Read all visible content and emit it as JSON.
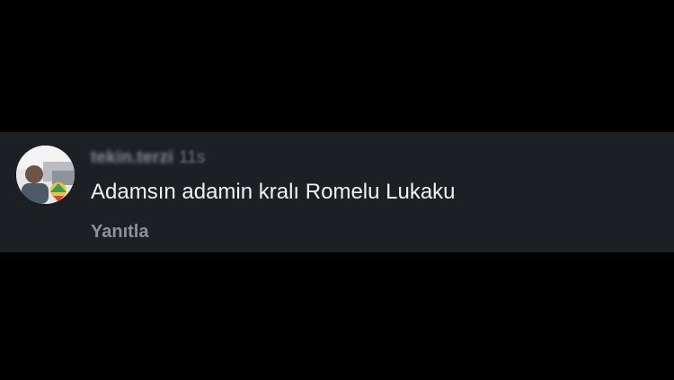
{
  "comment": {
    "username": "tekin.terzi",
    "timestamp": "11s",
    "text": "Adamsın adamin kralı Romelu Lukaku",
    "reply_label": "Yanıtla",
    "avatar_icon": "profile-photo"
  },
  "colors": {
    "page_background": "#000000",
    "card_background": "#1c1f24",
    "text_primary": "#f2f2f2",
    "text_secondary": "#8e9297"
  }
}
